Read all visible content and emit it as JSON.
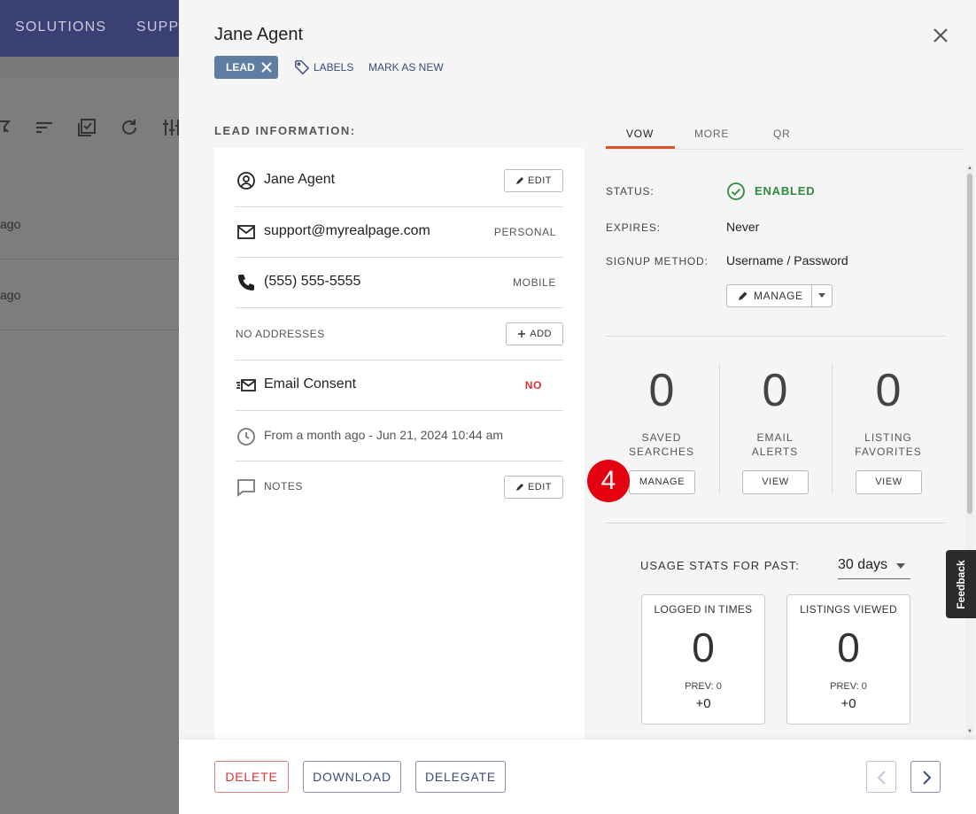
{
  "background": {
    "nav": [
      "SOLUTIONS",
      "SUPP"
    ],
    "rows": [
      "ago",
      "ago"
    ]
  },
  "drawer": {
    "title": "Jane Agent",
    "lead_chip": "LEAD",
    "labels_link": "LABELS",
    "mark_new": "MARK AS NEW",
    "section_title": "LEAD INFORMATION:",
    "lead": {
      "name": "Jane Agent",
      "edit_label": "EDIT",
      "email": "support@myrealpage.com",
      "email_type": "PERSONAL",
      "phone": "(555) 555-5555",
      "phone_type": "MOBILE",
      "addresses": "NO ADDRESSES",
      "add_label": "ADD",
      "consent_label": "Email Consent",
      "consent_value": "NO",
      "created": "From a month ago - Jun 21, 2024 10:44 am",
      "notes_label": "NOTES",
      "notes_edit": "EDIT"
    },
    "tabs": [
      "VOW",
      "MORE",
      "QR"
    ],
    "vow": {
      "status_label": "STATUS:",
      "status_value": "ENABLED",
      "expires_label": "EXPIRES:",
      "expires_value": "Never",
      "signup_label": "SIGNUP METHOD:",
      "signup_value": "Username / Password",
      "manage_label": "MANAGE"
    },
    "stats": [
      {
        "value": "0",
        "line1": "SAVED",
        "line2": "SEARCHES",
        "button": "MANAGE"
      },
      {
        "value": "0",
        "line1": "EMAIL",
        "line2": "ALERTS",
        "button": "VIEW"
      },
      {
        "value": "0",
        "line1": "LISTING",
        "line2": "FAVORITES",
        "button": "VIEW"
      }
    ],
    "step_badge": "4",
    "usage": {
      "label": "USAGE STATS FOR PAST:",
      "period": "30 days",
      "cards": [
        {
          "title": "LOGGED IN TIMES",
          "value": "0",
          "prev": "PREV: 0",
          "diff": "+0"
        },
        {
          "title": "LISTINGS VIEWED",
          "value": "0",
          "prev": "PREV: 0",
          "diff": "+0"
        }
      ]
    },
    "footer": {
      "delete": "DELETE",
      "download": "DOWNLOAD",
      "delegate": "DELEGATE"
    }
  },
  "feedback": "Feedback",
  "colors": {
    "accent_tab": "#d9542b",
    "enabled_green": "#2e8b3d",
    "no_red": "#d33",
    "badge_red": "#e3000f",
    "chip_blue": "#5d7ea0",
    "topbar": "#3a3f74"
  }
}
